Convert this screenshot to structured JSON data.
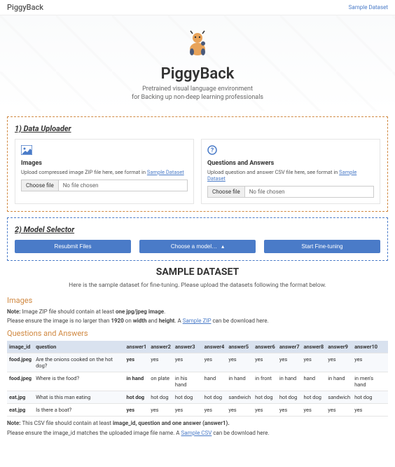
{
  "topbar": {
    "brand": "PiggyBack",
    "link": "Sample Dataset"
  },
  "hero": {
    "title": "PiggyBack",
    "sub1": "Pretrained visual language environment",
    "sub2": "for Backing up non-deep learning professionals"
  },
  "uploader": {
    "title": "1) Data Uploader",
    "images": {
      "heading": "Images",
      "desc_pre": "Upload compressed image ZIP file here, see format in ",
      "desc_link": "Sample Dataset",
      "choose": "Choose file",
      "fname": "No file chosen"
    },
    "qa": {
      "heading": "Questions and Answers",
      "desc_pre": "Upload question and answer CSV file here, see format in ",
      "desc_link": "Sample Dataset",
      "choose": "Choose file",
      "fname": "No file chosen"
    }
  },
  "model": {
    "title": "2) Model Selector",
    "resubmit": "Resubmit Files",
    "choose": "Choose a model…",
    "finetune": "Start Fine-tuning"
  },
  "sample": {
    "title": "SAMPLE DATASET",
    "desc": "Here is the sample dataset for fine-tuning. Please upload the datasets following the format below."
  },
  "images_sec": {
    "heading": "Images",
    "note1_pre": "Note: ",
    "note1_mid": "Image ZIP file should contain at least ",
    "note1_bold": "one jpg/jpeg image",
    "note1_post": ".",
    "note2_pre": "Please ensure the image is no larger than ",
    "note2_bold": "1920",
    "note2_mid": " on ",
    "note2_bold2": "width",
    "note2_mid2": " and ",
    "note2_bold3": "height",
    "note2_post": ". A ",
    "note2_link": "Sample ZIP",
    "note2_end": " can be download here."
  },
  "qa_sec": {
    "heading": "Questions and Answers"
  },
  "table": {
    "headers": [
      "image_id",
      "question",
      "answer1",
      "answer2",
      "answer3",
      "answer4",
      "answer5",
      "answer6",
      "answer7",
      "answer8",
      "answer9",
      "answer10"
    ],
    "rows": [
      [
        "food.jpeg",
        "Are the onions cooked on the hot dog?",
        "yes",
        "yes",
        "yes",
        "yes",
        "yes",
        "yes",
        "yes",
        "yes",
        "yes",
        "yes"
      ],
      [
        "food.jpeg",
        "Where is the food?",
        "in hand",
        "on plate",
        "in his hand",
        "hand",
        "in hand",
        "in front",
        "in hand",
        "hand",
        "in hand",
        "in men's hand"
      ],
      [
        "eat.jpg",
        "What is this man eating",
        "hot dog",
        "hot dog",
        "hot dog",
        "hot dog",
        "sandwich",
        "hot dog",
        "hot dog",
        "hot dog",
        "sandwich",
        "hot dog"
      ],
      [
        "eat.jpg",
        "Is there a boat?",
        "yes",
        "yes",
        "yes",
        "yes",
        "yes",
        "yes",
        "yes",
        "yes",
        "yes",
        "yes"
      ]
    ]
  },
  "footer": {
    "note1_pre": "Note: ",
    "note1_mid": "This CSV file should contain at least ",
    "note1_bold": "image_id, question and one answer (answer1).",
    "note2_pre": "Please ensure the image_id matches the uploaded image file name. A ",
    "note2_link": "Sample CSV",
    "note2_end": " can be download here."
  }
}
